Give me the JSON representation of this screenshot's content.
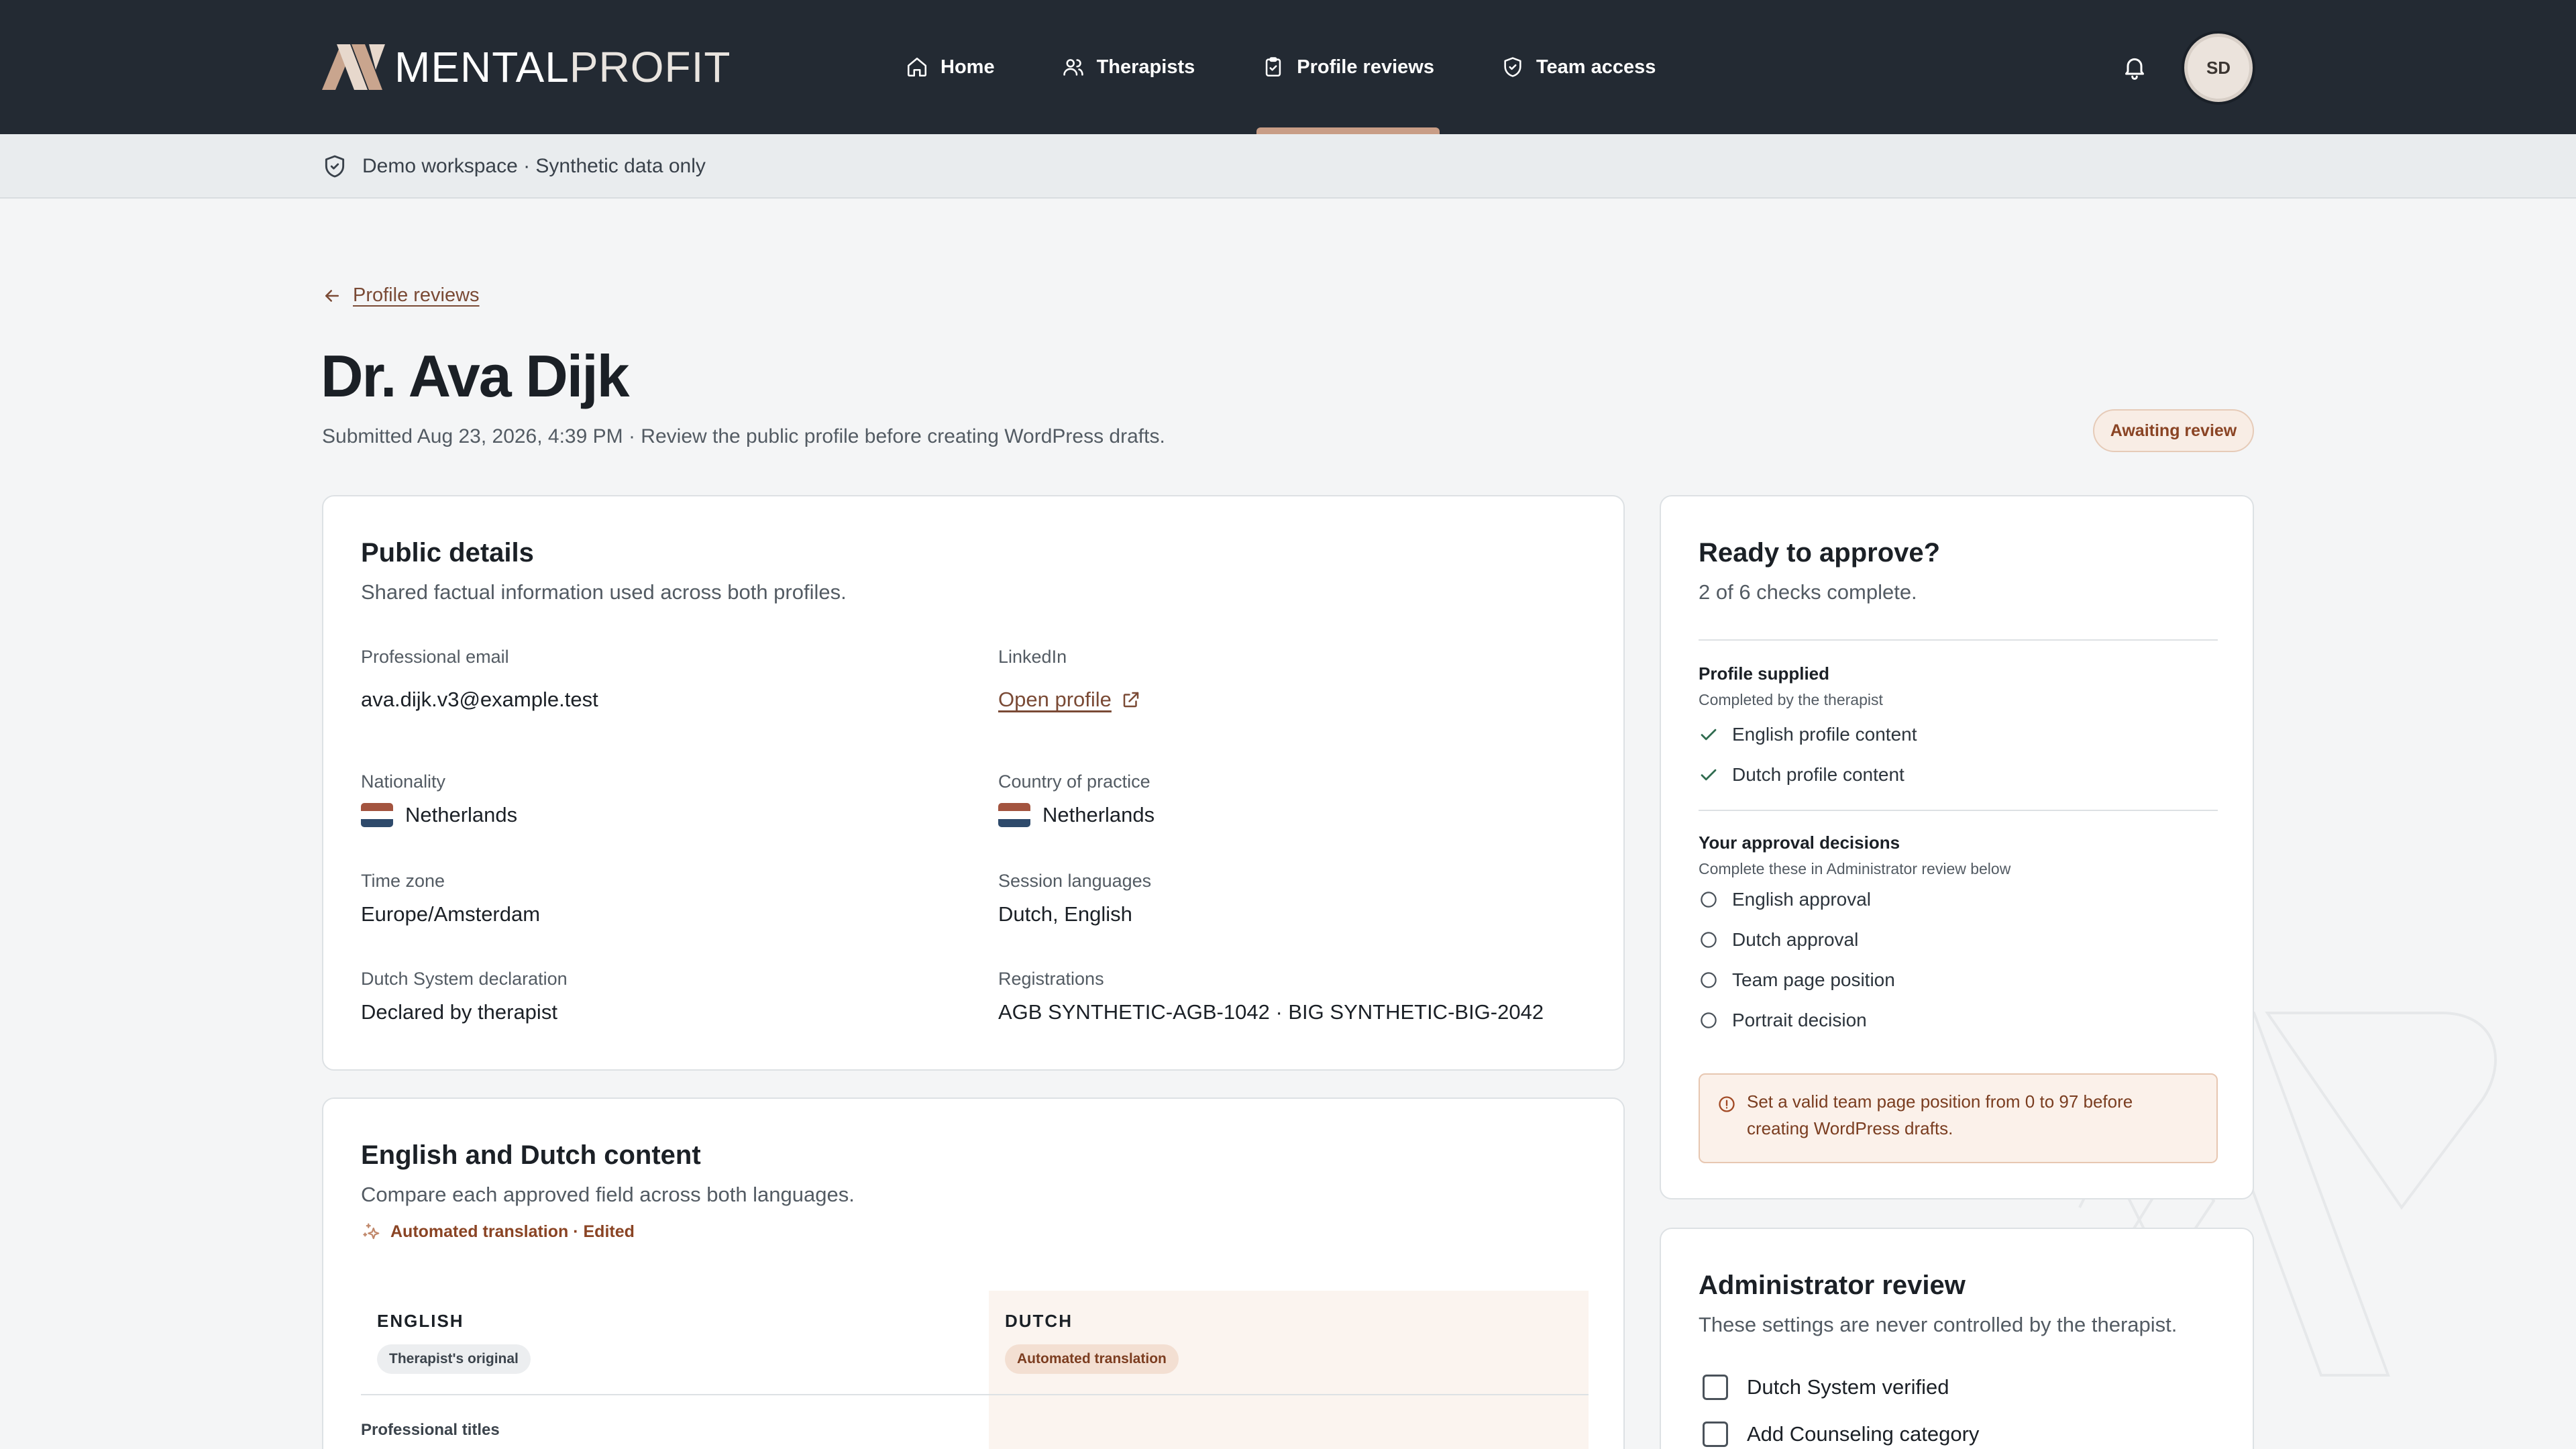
{
  "brand": {
    "name_bold": "MENTAL",
    "name_light": "PROFIT"
  },
  "nav": {
    "items": [
      {
        "label": "Home",
        "icon": "home-icon"
      },
      {
        "label": "Therapists",
        "icon": "users-icon"
      },
      {
        "label": "Profile reviews",
        "icon": "clipboard-check-icon",
        "active": true
      },
      {
        "label": "Team access",
        "icon": "shield-check-icon"
      }
    ],
    "avatar_initials": "SD"
  },
  "banner": {
    "text": "Demo workspace · Synthetic data only"
  },
  "header": {
    "back_label": "Profile reviews",
    "title": "Dr. Ava Dijk",
    "subtitle": "Submitted Aug 23, 2026, 4:39 PM · Review the public profile before creating WordPress drafts.",
    "status": "Awaiting review"
  },
  "public_details": {
    "title": "Public details",
    "description": "Shared factual information used across both profiles.",
    "fields": [
      {
        "label": "Professional email",
        "value": "ava.dijk.v3@example.test"
      },
      {
        "label": "LinkedIn",
        "value": "Open profile"
      },
      {
        "label": "Nationality",
        "value": "Netherlands"
      },
      {
        "label": "Country of practice",
        "value": "Netherlands"
      },
      {
        "label": "Time zone",
        "value": "Europe/Amsterdam"
      },
      {
        "label": "Session languages",
        "value": "Dutch, English"
      },
      {
        "label": "Dutch System declaration",
        "value": "Declared by therapist"
      },
      {
        "label": "Registrations",
        "value": "AGB SYNTHETIC-AGB-1042 · BIG SYNTHETIC-BIG-2042"
      }
    ]
  },
  "content": {
    "title": "English and Dutch content",
    "description": "Compare each approved field across both languages.",
    "auto_note": "Automated translation · Edited",
    "english": {
      "title": "ENGLISH",
      "tag": "Therapist's original"
    },
    "dutch": {
      "title": "DUTCH",
      "tag": "Automated translation"
    },
    "first_row_label": "Professional titles"
  },
  "ready": {
    "title": "Ready to approve?",
    "summary": "2 of 6 checks complete.",
    "supplied": {
      "title": "Profile supplied",
      "subtitle": "Completed by the therapist",
      "items": [
        "English profile content",
        "Dutch profile content"
      ]
    },
    "decisions": {
      "title": "Your approval decisions",
      "subtitle": "Complete these in Administrator review below",
      "items": [
        "English approval",
        "Dutch approval",
        "Team page position",
        "Portrait decision"
      ]
    },
    "alert": "Set a valid team page position from 0 to 97 before creating WordPress drafts."
  },
  "admin": {
    "title": "Administrator review",
    "description": "These settings are never controlled by the therapist.",
    "checkboxes": [
      "Dutch System verified",
      "Add Counseling category"
    ]
  },
  "colors": {
    "nav_bg": "#232a33",
    "accent": "#c89d86",
    "link": "#7a4a35",
    "badge_text": "#8a4424"
  }
}
